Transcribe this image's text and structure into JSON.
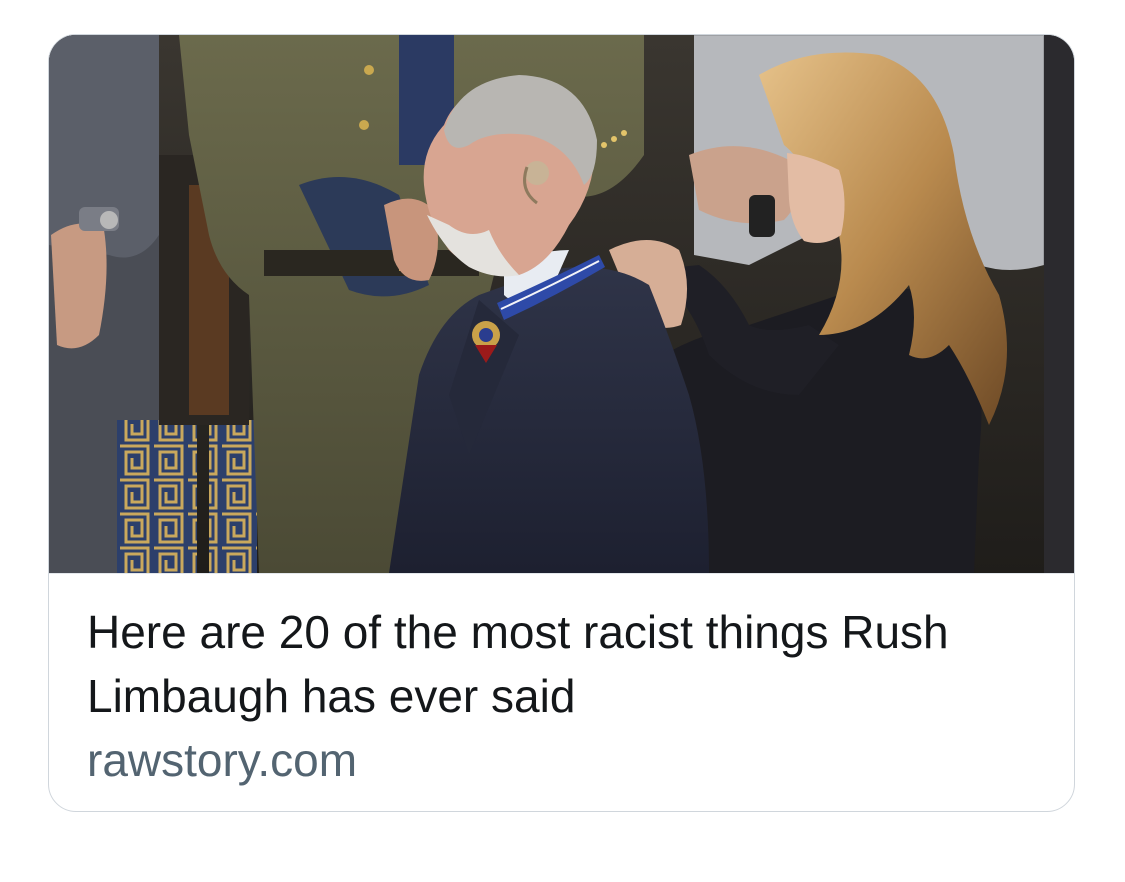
{
  "link_card": {
    "thumbnail": {
      "alt": ""
    },
    "headline": "Here are 20 of the most racist things Rush Limbaugh has ever said",
    "domain": "rawstory.com"
  },
  "colors": {
    "card_border": "#d0d6dc",
    "headline_text": "#14171a",
    "domain_text": "#536471",
    "background": "#ffffff"
  }
}
